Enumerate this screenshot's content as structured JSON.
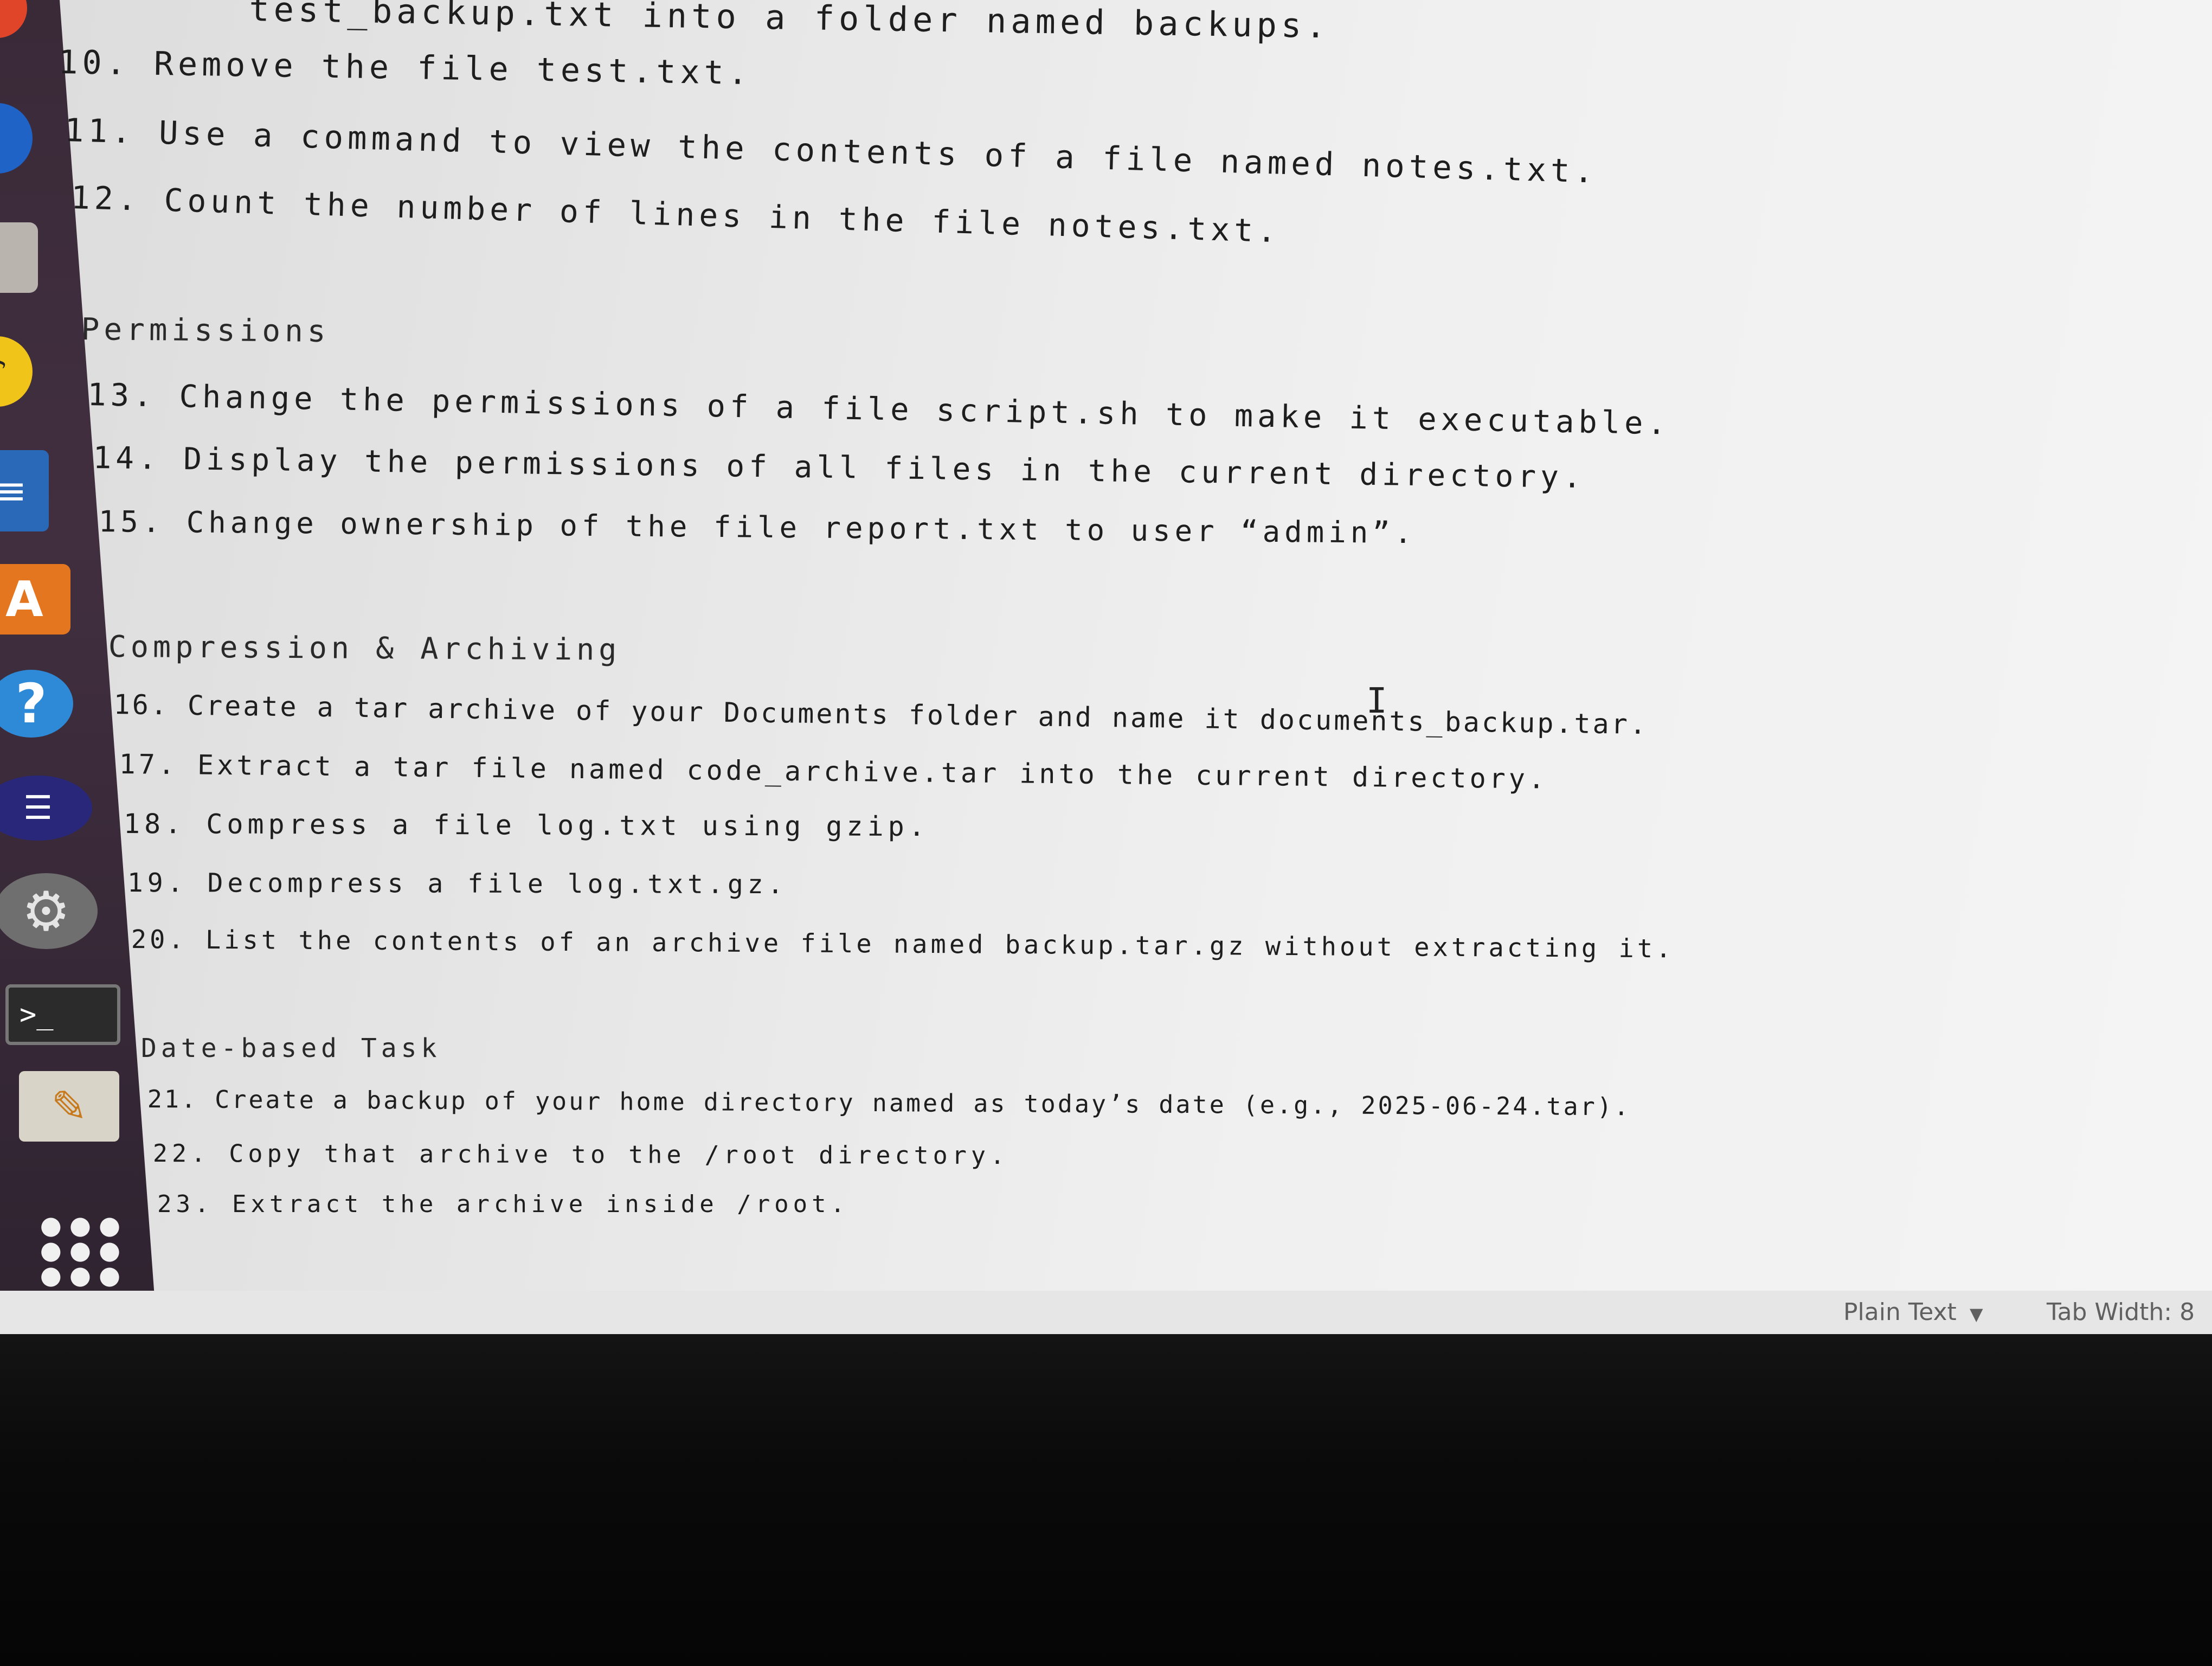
{
  "editor": {
    "lines": [
      {
        "text": "test_backup.txt into a folder named backups.",
        "kind": "item"
      },
      {
        "text": "10. Remove the file test.txt.",
        "kind": "item"
      },
      {
        "text": "11. Use a command to view the contents of a file named notes.txt.",
        "kind": "item"
      },
      {
        "text": "12. Count the number of lines in the file notes.txt.",
        "kind": "item"
      },
      {
        "text": "Permissions",
        "kind": "heading"
      },
      {
        "text": "13. Change the permissions of a file script.sh to make it executable.",
        "kind": "item"
      },
      {
        "text": "14. Display the permissions of all files in the current directory.",
        "kind": "item"
      },
      {
        "text": "15. Change ownership of the file report.txt to user “admin”.",
        "kind": "item"
      },
      {
        "text": "Compression & Archiving",
        "kind": "heading"
      },
      {
        "text": "16. Create a tar archive of your Documents folder and name it documents_backup.tar.",
        "kind": "item"
      },
      {
        "text": "17. Extract a tar file named code_archive.tar into the current directory.",
        "kind": "item"
      },
      {
        "text": "18. Compress a file log.txt using gzip.",
        "kind": "item"
      },
      {
        "text": "19. Decompress a file log.txt.gz.",
        "kind": "item"
      },
      {
        "text": "20. List the contents of an archive file named backup.tar.gz without extracting it.",
        "kind": "item"
      },
      {
        "text": "Date-based Task",
        "kind": "heading"
      },
      {
        "text": "21. Create a backup of your home directory named as today’s date (e.g., 2025-06-24.tar).",
        "kind": "item"
      },
      {
        "text": "22. Copy that archive to the /root directory.",
        "kind": "item"
      },
      {
        "text": "23. Extract the archive inside /root.",
        "kind": "item"
      }
    ]
  },
  "statusbar": {
    "language": "Plain Text",
    "tab_width": "Tab Width: 8"
  },
  "launcher": {
    "icons": [
      "firefox-icon",
      "thunderbird-icon",
      "files-icon",
      "rhythmbox-icon",
      "writer-icon",
      "software-center-icon",
      "help-icon",
      "drive-icon",
      "system-settings-icon",
      "terminal-icon",
      "text-editor-icon",
      "show-applications-icon"
    ]
  },
  "colors": {
    "launcher_bg": "#3a2a38",
    "editor_bg": "#ececec",
    "text": "#1e1e1e",
    "status_text": "#606060"
  }
}
